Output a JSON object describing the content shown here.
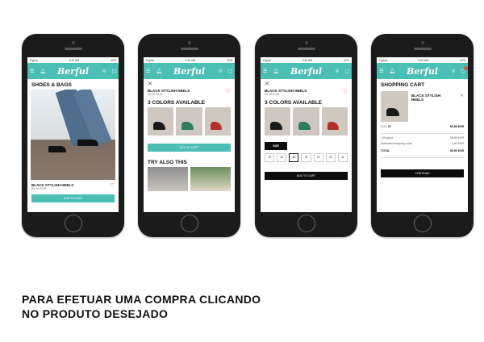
{
  "status": {
    "carrier": "Figma",
    "time": "9:42 AM",
    "battery": "42%"
  },
  "brand": "Berful",
  "cart_count": "1",
  "screen1": {
    "title": "SHOES & BAGS",
    "product_name": "BLACK STYLISH HEELS",
    "price": "59,99 EUR",
    "cta": "ADD TO CART"
  },
  "screen2": {
    "product_name": "BLACK STYLISH HEELS",
    "price": "59,99 EUR",
    "colors_title": "3 COLORS AVAILABLE",
    "cta": "ADD TO CART",
    "also_title": "TRY ALSO THIS"
  },
  "screen3": {
    "product_name": "BLACK STYLISH HEELS",
    "price": "59,99 EUR",
    "colors_title": "3 COLORS AVAILABLE",
    "size_label": "SIZE",
    "sizes": [
      "35",
      "36",
      "37",
      "38",
      "39",
      "40",
      "41"
    ],
    "selected_size": "37",
    "cta": "ADD TO CART"
  },
  "screen4": {
    "title": "SHOPPING CART",
    "item_name": "BLACK STYLISH HEELS",
    "size_label": "SIZE",
    "size_value": "37",
    "item_price": "59,99 EUR",
    "rows": [
      {
        "label": "1 Product",
        "value": "59,99 EUR"
      },
      {
        "label": "Estimated shipping costs",
        "value": "0,00 EUR"
      }
    ],
    "total_label": "TOTAL",
    "total_value": "59,99 EUR",
    "cta": "CONTINUE"
  },
  "caption": {
    "line1": "PARA EFETUAR UMA COMPRA CLICANDO",
    "line2": "NO PRODUTO DESEJADO"
  },
  "colors": {
    "accent": "#4bbeb6",
    "shoe_dark": "#1a1a1a",
    "shoe_green": "#2e7d5b",
    "shoe_red": "#b5302d"
  }
}
